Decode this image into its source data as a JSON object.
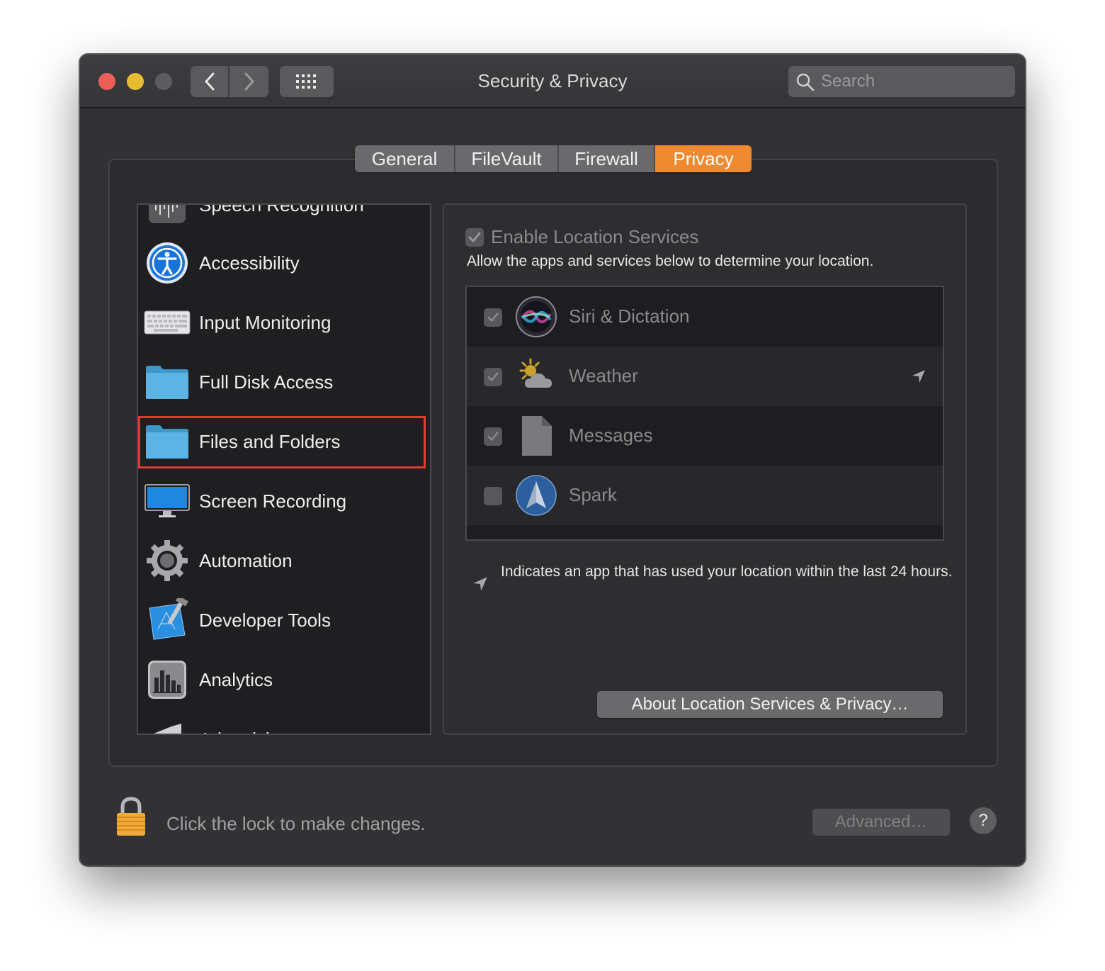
{
  "window": {
    "title": "Security & Privacy",
    "search_placeholder": "Search"
  },
  "tabs": [
    {
      "label": "General",
      "active": false
    },
    {
      "label": "FileVault",
      "active": false
    },
    {
      "label": "Firewall",
      "active": false
    },
    {
      "label": "Privacy",
      "active": true
    }
  ],
  "sidebar": {
    "items": [
      {
        "label": "Speech Recognition",
        "icon": "waveform-icon"
      },
      {
        "label": "Accessibility",
        "icon": "accessibility-icon"
      },
      {
        "label": "Input Monitoring",
        "icon": "keyboard-icon"
      },
      {
        "label": "Full Disk Access",
        "icon": "folder-icon"
      },
      {
        "label": "Files and Folders",
        "icon": "folder-icon",
        "highlighted": true
      },
      {
        "label": "Screen Recording",
        "icon": "display-icon"
      },
      {
        "label": "Automation",
        "icon": "gear-icon"
      },
      {
        "label": "Developer Tools",
        "icon": "xcode-icon"
      },
      {
        "label": "Analytics",
        "icon": "chart-icon"
      },
      {
        "label": "Advertising",
        "icon": "megaphone-icon"
      }
    ]
  },
  "location": {
    "enable_label": "Enable Location Services",
    "enabled": true,
    "allow_text": "Allow the apps and services below to determine your location.",
    "apps": [
      {
        "name": "Siri & Dictation",
        "checked": true,
        "recent": false,
        "icon": "siri-icon"
      },
      {
        "name": "Weather",
        "checked": true,
        "recent": true,
        "icon": "weather-icon"
      },
      {
        "name": "Messages",
        "checked": true,
        "recent": false,
        "icon": "document-icon"
      },
      {
        "name": "Spark",
        "checked": false,
        "recent": false,
        "icon": "spark-icon"
      }
    ],
    "legend_text": "Indicates an app that has used your location within the last 24 hours.",
    "about_button": "About Location Services & Privacy…"
  },
  "footer": {
    "lock_text": "Click the lock to make changes.",
    "advanced_button": "Advanced…",
    "help_button": "?"
  },
  "colors": {
    "accent": "#f08a31",
    "highlight_border": "#e03a31",
    "window_bg": "#323234"
  }
}
